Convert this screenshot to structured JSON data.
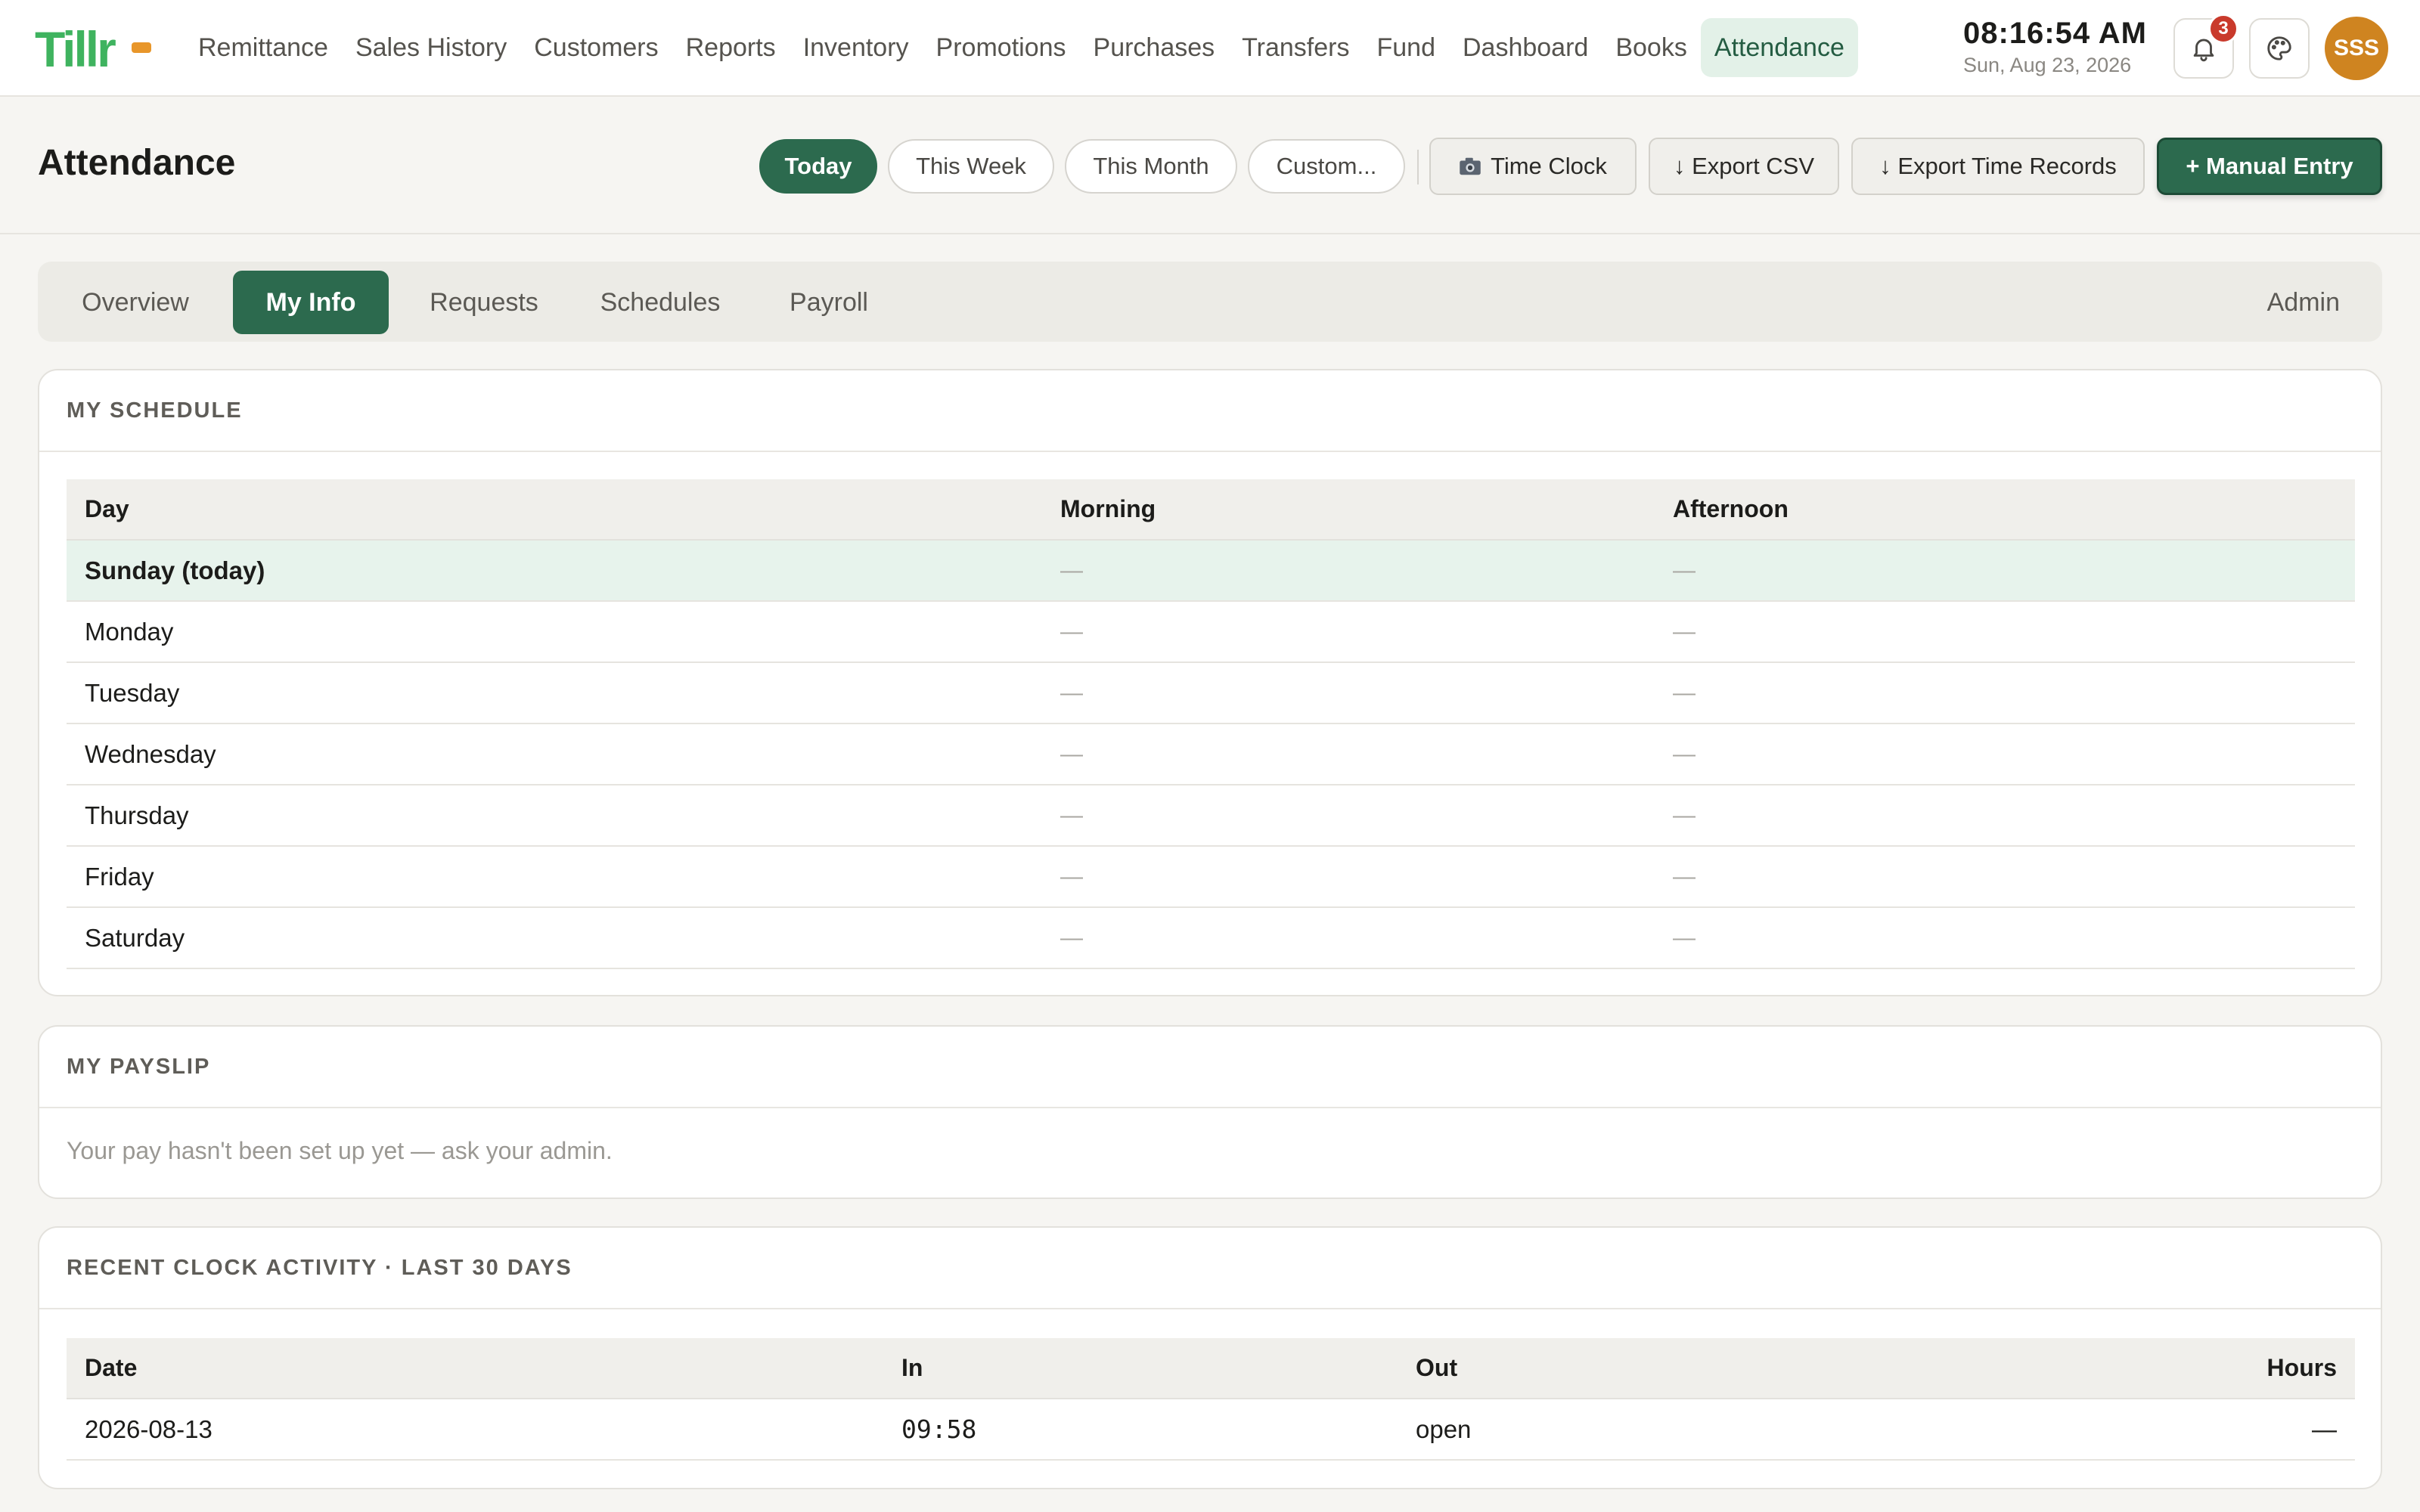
{
  "app": {
    "logo_text": "Tillr"
  },
  "nav": {
    "items": [
      {
        "label": "Remittance"
      },
      {
        "label": "Sales History"
      },
      {
        "label": "Customers"
      },
      {
        "label": "Reports"
      },
      {
        "label": "Inventory"
      },
      {
        "label": "Promotions"
      },
      {
        "label": "Purchases"
      },
      {
        "label": "Transfers"
      },
      {
        "label": "Fund"
      },
      {
        "label": "Dashboard"
      },
      {
        "label": "Books"
      },
      {
        "label": "Attendance",
        "active": true
      }
    ]
  },
  "clock": {
    "time": "08:16:54 AM",
    "date": "Sun, Aug 23, 2026"
  },
  "notifications": {
    "count": "3",
    "icon": "bell-icon"
  },
  "theme": {
    "icon": "palette-icon"
  },
  "user": {
    "initials": "SSS"
  },
  "page": {
    "title": "Attendance"
  },
  "ranges": {
    "today": "Today",
    "this_week": "This Week",
    "this_month": "This Month",
    "custom": "Custom..."
  },
  "actions": {
    "time_clock": "Time Clock",
    "export_csv": "↓ Export CSV",
    "export_time_records": "↓ Export Time Records",
    "manual_entry": "+ Manual Entry"
  },
  "tabs": {
    "overview": "Overview",
    "my_info": "My Info",
    "requests": "Requests",
    "schedules": "Schedules",
    "payroll": "Payroll",
    "admin": "Admin"
  },
  "schedule": {
    "title": "MY SCHEDULE",
    "headers": {
      "day": "Day",
      "morning": "Morning",
      "afternoon": "Afternoon"
    },
    "rows": [
      {
        "day": "Sunday (today)",
        "morning": "—",
        "afternoon": "—"
      },
      {
        "day": "Monday",
        "morning": "—",
        "afternoon": "—"
      },
      {
        "day": "Tuesday",
        "morning": "—",
        "afternoon": "—"
      },
      {
        "day": "Wednesday",
        "morning": "—",
        "afternoon": "—"
      },
      {
        "day": "Thursday",
        "morning": "—",
        "afternoon": "—"
      },
      {
        "day": "Friday",
        "morning": "—",
        "afternoon": "—"
      },
      {
        "day": "Saturday",
        "morning": "—",
        "afternoon": "—"
      }
    ]
  },
  "payslip": {
    "title": "MY PAYSLIP",
    "message": "Your pay hasn't been set up yet — ask your admin."
  },
  "activity": {
    "title": "RECENT CLOCK ACTIVITY · LAST 30 DAYS",
    "headers": {
      "date": "Date",
      "in": "In",
      "out": "Out",
      "hours": "Hours"
    },
    "rows": [
      {
        "date": "2026-08-13",
        "in": "09:58",
        "out": "open",
        "hours": "—"
      }
    ]
  },
  "colors": {
    "brand_green": "#2c6a4e",
    "brand_orange": "#e8962a",
    "logo_green": "#3fb35f",
    "badge_red": "#c93a2c",
    "avatar": "#cf8420"
  }
}
